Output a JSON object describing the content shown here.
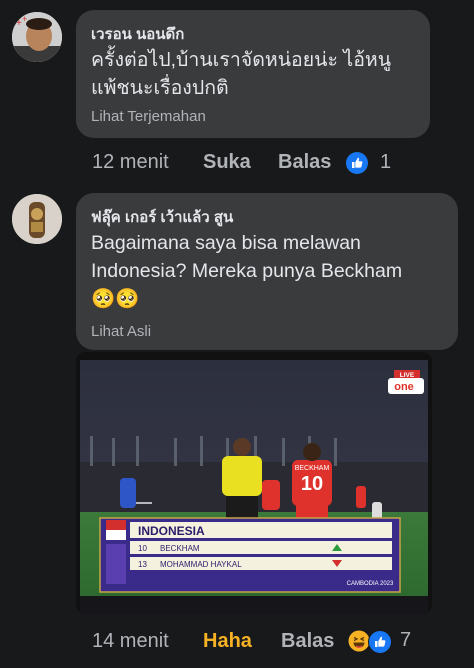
{
  "comments": [
    {
      "author": "เวรอน นอนดึก",
      "text_lines": [
        "ครั้งต่อไป,บ้านเราจัดหน่อยน่ะ ไอ้หนู",
        "แพ้ชนะเรื่องปกติ"
      ],
      "translate_label": "Lihat Terjemahan",
      "time": "12 menit",
      "reaction_label": "Suka",
      "reply_label": "Balas",
      "reaction_count": "1",
      "reaction_icon": "like-icon"
    },
    {
      "author": "ฟลุ๊ค เกอร์ เว้าแล้ว สูน",
      "text_lines": [
        "Bagaimana saya bisa melawan",
        "Indonesia? Mereka punya Beckham"
      ],
      "emojis": "🥺🥺",
      "translate_label": "Lihat Asli",
      "time": "14 menit",
      "reaction_label": "Haha",
      "reply_label": "Balas",
      "reaction_count": "7",
      "reaction_icon": "haha-like-icons"
    }
  ],
  "photo": {
    "broadcast_logo": "one",
    "live_label": "LIVE",
    "team": "INDONESIA",
    "players": [
      {
        "number": "10",
        "name": "BECKHAM"
      },
      {
        "number": "13",
        "name": "MOHAMMAD HAYKAL"
      }
    ],
    "event_label": "CAMBODIA 2023",
    "player_shirt_number": "10",
    "player_shirt_name": "BECKHAM"
  },
  "colors": {
    "background": "#18191a",
    "bubble": "#3a3b3c",
    "text": "#e4e6eb",
    "muted": "#b0b3b8",
    "haha_accent": "#f7b125",
    "like_blue": "#1877f2"
  }
}
